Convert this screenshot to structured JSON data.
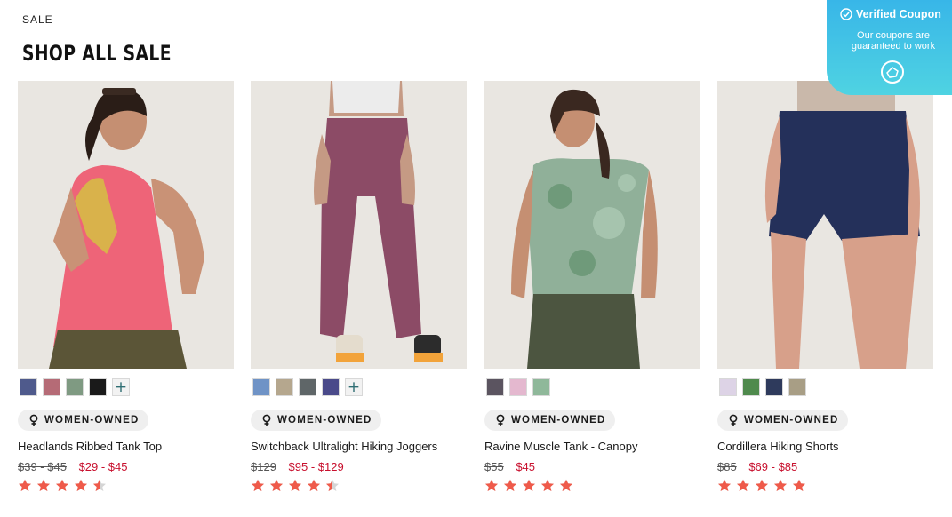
{
  "breadcrumb": "SALE",
  "title": "SHOP ALL SALE",
  "coupon": {
    "title": "Verified Coupon",
    "subtitle": "Our coupons are guaranteed to work",
    "bg_from": "#38b6e8",
    "bg_to": "#4fd3e2"
  },
  "products": [
    {
      "name": "Headlands Ribbed Tank Top",
      "badge": "WOMEN-OWNED",
      "price_was": "$39 - $45",
      "price_now": "$29 - $45",
      "rating": 4.5,
      "swatches": [
        "#4f5a8c",
        "#b56b76",
        "#7f9a82",
        "#1a1a1a"
      ],
      "more_label": "+"
    },
    {
      "name": "Switchback Ultralight Hiking Joggers",
      "badge": "WOMEN-OWNED",
      "price_was": "$129",
      "price_now": "$95 - $129",
      "rating": 4.5,
      "swatches": [
        "#6f93c6",
        "#b5a78e",
        "#5f6668",
        "#4a4a8a"
      ],
      "more_label": "+"
    },
    {
      "name": "Ravine Muscle Tank - Canopy",
      "badge": "WOMEN-OWNED",
      "price_was": "$55",
      "price_now": "$45",
      "rating": 5,
      "swatches": [
        "#5b5460",
        "#e4b8cf",
        "#8fb89a"
      ],
      "more_label": ""
    },
    {
      "name": "Cordillera Hiking Shorts",
      "badge": "WOMEN-OWNED",
      "price_was": "$85",
      "price_now": "$69 - $85",
      "rating": 5,
      "swatches": [
        "#ddd3e6",
        "#4f8a4d",
        "#2e3a5c",
        "#a89e85"
      ],
      "more_label": ""
    }
  ],
  "colors": {
    "sale_price": "#c8102e",
    "star": "#ef5a4a",
    "star_empty": "#d5d5d5"
  }
}
